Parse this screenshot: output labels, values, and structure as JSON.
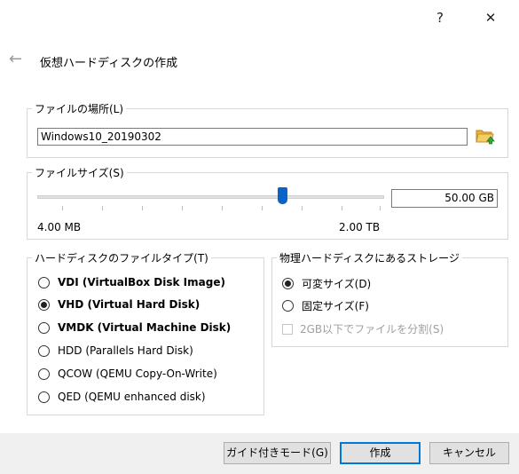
{
  "titlebar": {
    "help_label": "?",
    "close_label": "✕"
  },
  "header": {
    "back_icon": "arrow-left-icon",
    "title": "仮想ハードディスクの作成"
  },
  "file_location": {
    "legend": "ファイルの場所(L)",
    "path_value": "Windows10_20190302",
    "folder_icon": "folder-open-icon"
  },
  "file_size": {
    "legend": "ファイルサイズ(S)",
    "slider_min_label": "4.00 MB",
    "slider_max_label": "2.00 TB",
    "size_value": "50.00 GB",
    "slider_level": 0.66
  },
  "file_type": {
    "legend": "ハードディスクのファイルタイプ(T)",
    "options": [
      {
        "label": "VDI (VirtualBox Disk Image)",
        "selected": false,
        "bold": true
      },
      {
        "label": "VHD (Virtual Hard Disk)",
        "selected": true,
        "bold": true
      },
      {
        "label": "VMDK (Virtual Machine Disk)",
        "selected": false,
        "bold": true
      },
      {
        "label": "HDD (Parallels Hard Disk)",
        "selected": false,
        "bold": false
      },
      {
        "label": "QCOW (QEMU Copy-On-Write)",
        "selected": false,
        "bold": false
      },
      {
        "label": "QED (QEMU enhanced disk)",
        "selected": false,
        "bold": false
      }
    ]
  },
  "storage": {
    "legend": "物理ハードディスクにあるストレージ",
    "options": [
      {
        "label": "可変サイズ(D)",
        "selected": true
      },
      {
        "label": "固定サイズ(F)",
        "selected": false
      }
    ],
    "split_label": "2GB以下でファイルを分割(S)"
  },
  "footer": {
    "guided_label": "ガイド付きモード(G)",
    "create_label": "作成",
    "cancel_label": "キャンセル"
  }
}
